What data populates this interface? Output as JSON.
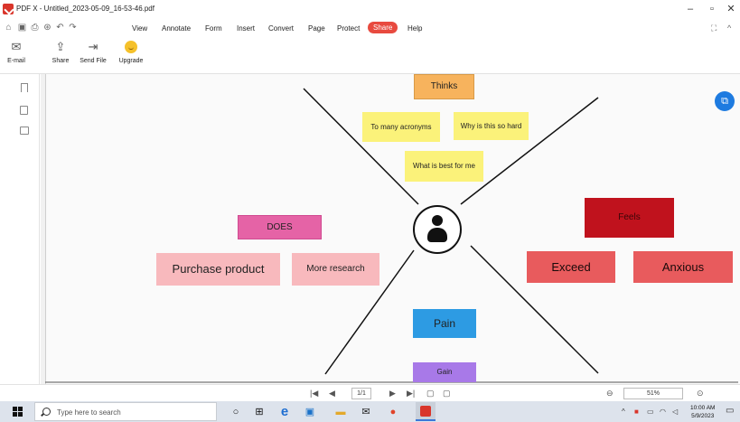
{
  "window": {
    "title": "PDF X - Untitled_2023-05-09_16-53-46.pdf",
    "min_icon": "minimize-icon",
    "max_icon": "maximize-icon",
    "close_icon": "close-icon",
    "min_glyph": "–",
    "max_glyph": "▫",
    "close_glyph": "✕"
  },
  "menu": {
    "items": [
      "View",
      "Annotate",
      "Form",
      "Insert",
      "Convert",
      "Page",
      "Protect",
      "Share",
      "Help"
    ],
    "active": "Share",
    "accent": "#e84a3f"
  },
  "ribbon": {
    "buttons": [
      {
        "label": "E-mail",
        "icon": "mail-icon"
      },
      {
        "label": "Share",
        "icon": "share-icon"
      },
      {
        "label": "Send File",
        "icon": "send-file-icon"
      },
      {
        "label": "Upgrade",
        "icon": "smiley-icon"
      }
    ]
  },
  "board": {
    "thinks": "Thinks",
    "note_acronyms": "To many acronyms",
    "note_hard": "Why is this so hard",
    "note_best": "What is best for me",
    "does": "DOES",
    "purchase": "Purchase product",
    "research": "More research",
    "feels": "Feels",
    "exceed": "Exceed",
    "anxious": "Anxious",
    "pain": "Pain",
    "gain": "Gain",
    "colors": {
      "thinks": "#f7b35d",
      "sticky": "#fbf27a",
      "does": "#e563a6",
      "does_items": "#f8b9bd",
      "feels": "#c0121d",
      "feels_items": "#e85b5d",
      "pain": "#2d9be3",
      "gain": "#a879e8"
    }
  },
  "navigation": {
    "page_indicator": "1/1",
    "zoom": "51%"
  },
  "taskbar": {
    "search_placeholder": "Type here to search",
    "time": "10:00 AM",
    "date": "5/9/2023"
  }
}
